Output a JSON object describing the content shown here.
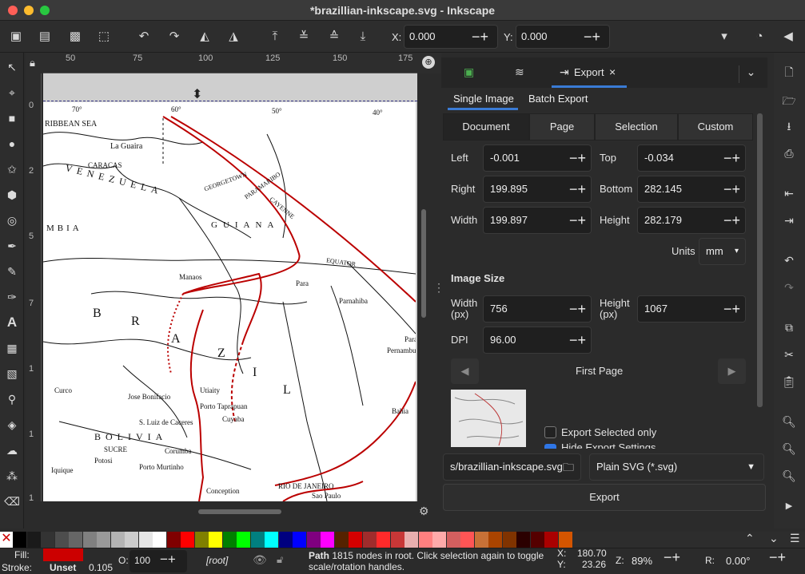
{
  "window": {
    "title": "*brazillian-inkscape.svg - Inkscape",
    "traffic": [
      "#ff5f57",
      "#febc2e",
      "#28c840"
    ]
  },
  "toolbar": {
    "x_label": "X:",
    "x_value": "0.000",
    "y_label": "Y:",
    "y_value": "0.000"
  },
  "ruler": {
    "h": [
      "50",
      "75",
      "100",
      "125",
      "150",
      "175"
    ],
    "v": [
      "0",
      "2",
      "5",
      "7",
      "1",
      "1",
      "1"
    ]
  },
  "panel": {
    "tabs": [
      "Export"
    ],
    "subtabs": [
      "Single Image",
      "Batch Export"
    ],
    "areas": [
      "Document",
      "Page",
      "Selection",
      "Custom"
    ],
    "left_label": "Left",
    "left_value": "-0.001",
    "top_label": "Top",
    "top_value": "-0.034",
    "right_label": "Right",
    "right_value": "199.895",
    "bottom_label": "Bottom",
    "bottom_value": "282.145",
    "width_label": "Width",
    "width_value": "199.897",
    "height_label": "Height",
    "height_value": "282.179",
    "units_label": "Units",
    "units_value": "mm",
    "image_size_heading": "Image Size",
    "px_width_label": "Width\n(px)",
    "px_width_value": "756",
    "px_height_label": "Height\n(px)",
    "px_height_value": "1067",
    "dpi_label": "DPI",
    "dpi_value": "96.00",
    "page_nav_label": "First Page",
    "export_selected_only": "Export Selected only",
    "hide_export_settings": "Hide Export Settings",
    "filename": "s/brazillian-inkscape.svg",
    "format": "Plain SVG (*.svg)",
    "export_button": "Export"
  },
  "map": {
    "labels": [
      "RIBBEAN SEA",
      "La Guaira",
      "CARACAS",
      "VENEZUELA",
      "GEORGETOWN",
      "PARAMARIBO",
      "CAYENNE",
      "GUIANA",
      "MBIA",
      "EQUATOR",
      "Manaos",
      "Para",
      "Parnahiba",
      "B",
      "R",
      "A",
      "Z",
      "I",
      "L",
      "Utiaity",
      "Jose Bonifacio",
      "Porto Taprapuan",
      "S. Luiz de Caceres",
      "Cuyaba",
      "BOLIVIA",
      "SUCRE",
      "Corumba",
      "Porto Murtinho",
      "Iquique",
      "Potosi",
      "RIO DE JANEIRO",
      "Sao Paulo",
      "Bahia",
      "Pernambuco",
      "Parai",
      "Conception",
      "Curco"
    ],
    "lat": [
      "70°",
      "60°",
      "50°",
      "40°"
    ]
  },
  "palette": [
    "#000000",
    "#1a1a1a",
    "#333333",
    "#4d4d4d",
    "#666666",
    "#808080",
    "#999999",
    "#b3b3b3",
    "#cccccc",
    "#e6e6e6",
    "#ffffff",
    "#800000",
    "#ff0000",
    "#808000",
    "#ffff00",
    "#008000",
    "#00ff00",
    "#008080",
    "#00ffff",
    "#000080",
    "#0000ff",
    "#800080",
    "#ff00ff",
    "#552200",
    "#d40000",
    "#a02c2c",
    "#ff2a2a",
    "#c83737",
    "#e9afaf",
    "#ff8080",
    "#ffaaaa",
    "#d35f5f",
    "#ff5555",
    "#c87137",
    "#aa4400",
    "#803300",
    "#2b0000",
    "#550000",
    "#aa0000",
    "#d45500"
  ],
  "status": {
    "fill_label": "Fill:",
    "fill_color": "#cc0000",
    "stroke_label": "Stroke:",
    "stroke_value": "Unset",
    "stroke_width": "0.105",
    "opacity_label": "O:",
    "opacity_value": "100",
    "layer": "[root]",
    "message_bold": "Path",
    "message": " 1815 nodes in root. Click selection again to toggle scale/rotation handles.",
    "x_label": "X:",
    "x_value": "180.70",
    "y_label": "Y:",
    "y_value": "23.26",
    "zoom_label": "Z:",
    "zoom_value": "89%",
    "rot_label": "R:",
    "rot_value": "0.00°"
  }
}
